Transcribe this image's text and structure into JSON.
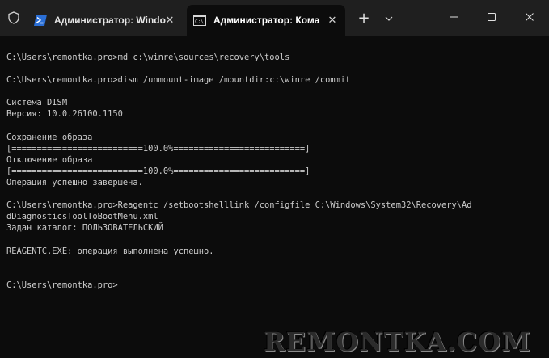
{
  "window": {
    "tabs": [
      {
        "label": "Администратор: Windo",
        "icon": "powershell-icon",
        "active": false,
        "close": "✕"
      },
      {
        "label": "Администратор: Кома",
        "icon": "cmd-icon",
        "active": true,
        "close": "✕"
      }
    ],
    "new_tab": "+",
    "dropdown_icon": "chevron-down-icon",
    "controls": [
      "minimize-icon",
      "maximize-icon",
      "close-icon"
    ]
  },
  "terminal": {
    "lines": [
      "C:\\Users\\remontka.pro>md c:\\winre\\sources\\recovery\\tools",
      "",
      "C:\\Users\\remontka.pro>dism /unmount-image /mountdir:c:\\winre /commit",
      "",
      "Система DISM",
      "Версия: 10.0.26100.1150",
      "",
      "Сохранение образа",
      "[==========================100.0%==========================]",
      "Отключение образа",
      "[==========================100.0%==========================]",
      "Операция успешно завершена.",
      "",
      "C:\\Users\\remontka.pro>Reagentc /setbootshelllink /configfile C:\\Windows\\System32\\Recovery\\Ad",
      "dDiagnosticsToolToBootMenu.xml",
      "Задан каталог: ПОЛЬЗОВАТЕЛЬСКИЙ",
      "",
      "REAGENTC.EXE: операция выполнена успешно.",
      "",
      "",
      "C:\\Users\\remontka.pro>"
    ]
  },
  "watermark": "REMONTKA.COM",
  "colors": {
    "titlebar": "#1f1f1f",
    "terminal_bg": "#0c0c0c",
    "terminal_text": "#cccccc",
    "powershell_blue": "#2b6fd6"
  }
}
